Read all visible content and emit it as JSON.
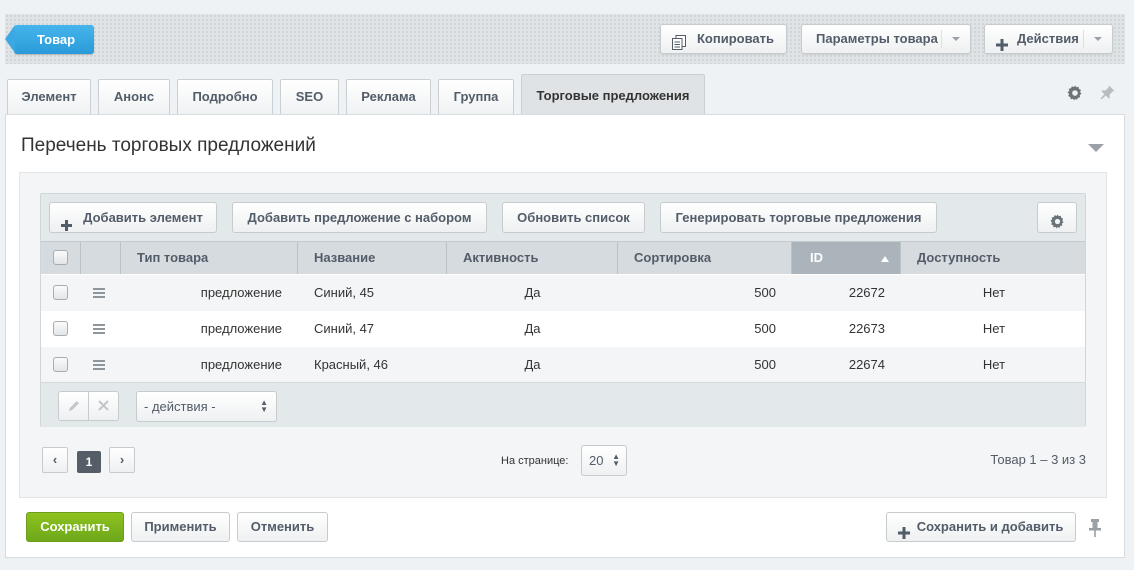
{
  "topbar": {
    "back_label": "Товар",
    "copy_label": "Копировать",
    "params_label": "Параметры товара",
    "actions_label": "Действия"
  },
  "tabs": [
    {
      "label": "Элемент"
    },
    {
      "label": "Анонс"
    },
    {
      "label": "Подробно"
    },
    {
      "label": "SEO"
    },
    {
      "label": "Реклама"
    },
    {
      "label": "Группа"
    },
    {
      "label": "Торговые предложения"
    }
  ],
  "section": {
    "title": "Перечень торговых предложений"
  },
  "grid": {
    "toolbar": {
      "add_element": "Добавить элемент",
      "add_with_set": "Добавить предложение с набором",
      "refresh": "Обновить список",
      "generate": "Генерировать торговые предложения"
    },
    "columns": [
      "Тип товара",
      "Название",
      "Активность",
      "Сортировка",
      "ID",
      "Доступность"
    ],
    "rows": [
      {
        "type": "предложение",
        "name": "Синий, 45",
        "active": "Да",
        "sort": "500",
        "id": "22672",
        "available": "Нет"
      },
      {
        "type": "предложение",
        "name": "Синий, 47",
        "active": "Да",
        "sort": "500",
        "id": "22673",
        "available": "Нет"
      },
      {
        "type": "предложение",
        "name": "Красный, 46",
        "active": "Да",
        "sort": "500",
        "id": "22674",
        "available": "Нет"
      }
    ],
    "actions_select": "- действия -"
  },
  "pager": {
    "prev": "‹",
    "current": "1",
    "next": "›",
    "per_page_label": "На странице:",
    "per_page_value": "20",
    "total": "Товар 1 – 3 из 3"
  },
  "footer": {
    "save": "Сохранить",
    "apply": "Применить",
    "cancel": "Отменить",
    "save_add": "Сохранить и добавить"
  },
  "colors": {
    "accent": "#2a9bd9",
    "save_green": "#7ab51d",
    "sorted_header": "#aab4ba"
  }
}
